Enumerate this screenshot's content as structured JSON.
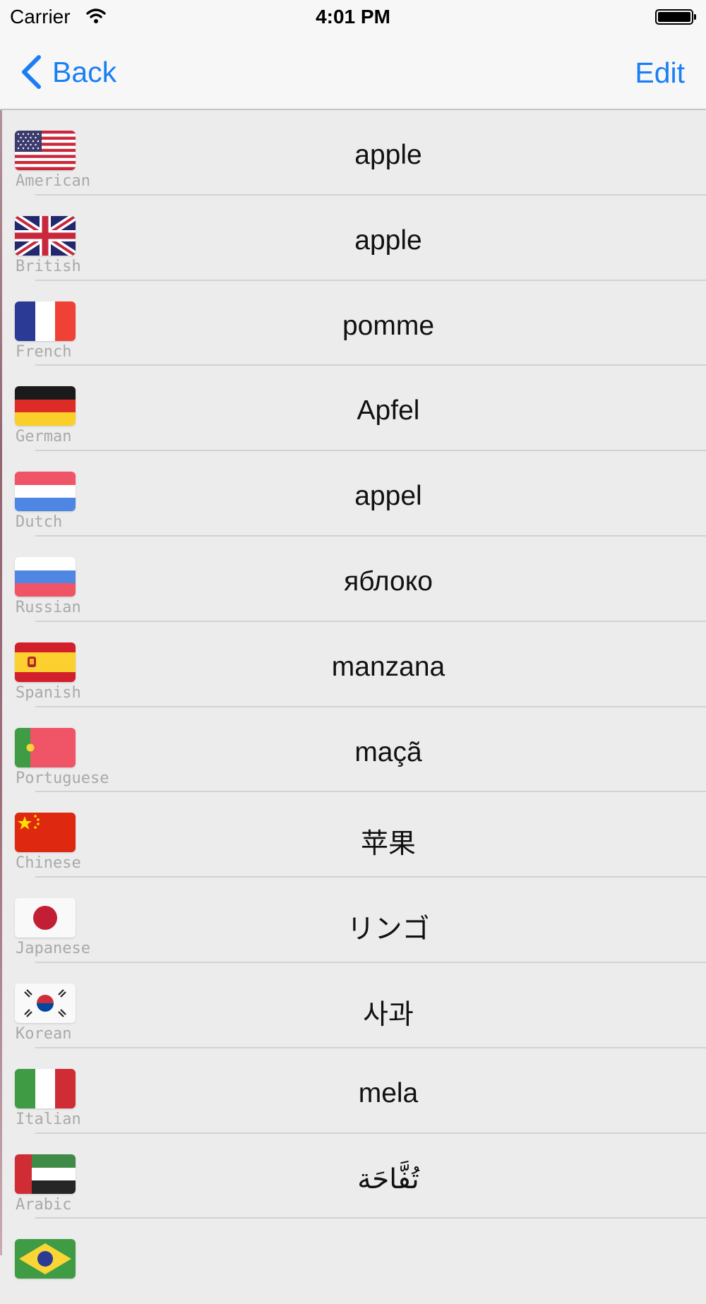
{
  "status_bar": {
    "carrier": "Carrier",
    "time": "4:01 PM",
    "wifi_icon": "wifi-icon",
    "battery_icon": "battery-icon"
  },
  "nav_bar": {
    "back_label": "Back",
    "back_icon": "chevron-left-icon",
    "edit_label": "Edit",
    "accent_color": "#1a7ff5"
  },
  "rows": [
    {
      "flag": "us-flag-icon",
      "language": "American",
      "word": "apple"
    },
    {
      "flag": "uk-flag-icon",
      "language": "British",
      "word": "apple"
    },
    {
      "flag": "fr-flag-icon",
      "language": "French",
      "word": "pomme"
    },
    {
      "flag": "de-flag-icon",
      "language": "German",
      "word": "Apfel"
    },
    {
      "flag": "nl-flag-icon",
      "language": "Dutch",
      "word": "appel"
    },
    {
      "flag": "ru-flag-icon",
      "language": "Russian",
      "word": "яблоко"
    },
    {
      "flag": "es-flag-icon",
      "language": "Spanish",
      "word": "manzana"
    },
    {
      "flag": "pt-flag-icon",
      "language": "Portuguese",
      "word": "maçã"
    },
    {
      "flag": "cn-flag-icon",
      "language": "Chinese",
      "word": "苹果"
    },
    {
      "flag": "jp-flag-icon",
      "language": "Japanese",
      "word": "リンゴ"
    },
    {
      "flag": "kr-flag-icon",
      "language": "Korean",
      "word": "사과"
    },
    {
      "flag": "it-flag-icon",
      "language": "Italian",
      "word": "mela"
    },
    {
      "flag": "ae-flag-icon",
      "language": "Arabic",
      "word": "تُفَّاحَة"
    },
    {
      "flag": "br-flag-icon",
      "language": "",
      "word": ""
    }
  ]
}
